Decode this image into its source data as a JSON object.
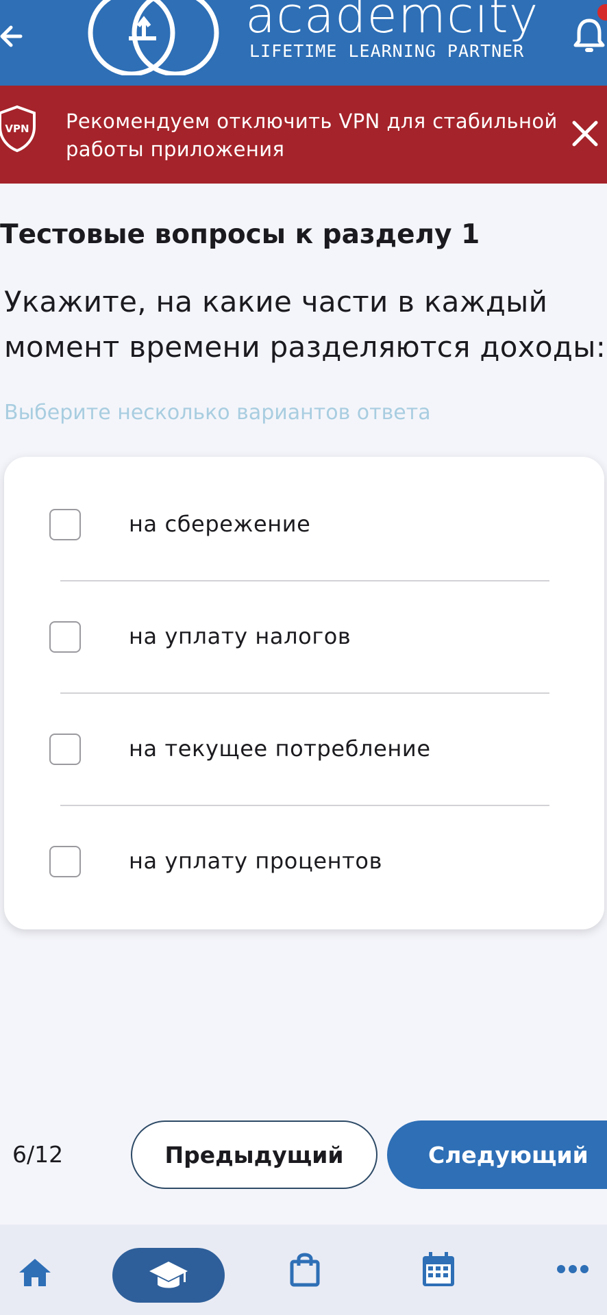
{
  "header": {
    "logo_word": "academcity",
    "logo_tagline": "LIFETIME LEARNING PARTNER",
    "icons": {
      "back": "arrow-left-icon",
      "bell": "bell-icon"
    }
  },
  "vpn_banner": {
    "badge": "VPN",
    "text": "Рекомендуем отключить VPN для стабильной работы приложения",
    "icons": {
      "shield": "vpn-shield-icon",
      "close": "close-icon"
    }
  },
  "content": {
    "section_title": "Тестовые вопросы к разделу 1",
    "question": "Укажите, на какие части в каждый момент времени разделяются доходы:",
    "hint": "Выберите несколько вариантов ответа",
    "options": [
      {
        "label": "на сбережение",
        "checked": false
      },
      {
        "label": "на уплату налогов",
        "checked": false
      },
      {
        "label": "на текущее потребление",
        "checked": false
      },
      {
        "label": "на уплату процентов",
        "checked": false
      }
    ]
  },
  "pager": {
    "progress": "6/12",
    "prev_label": "Предыдущий",
    "next_label": "Следующий"
  },
  "bottom_nav": {
    "items": [
      {
        "icon": "home-icon",
        "active": false
      },
      {
        "icon": "graduation-cap-icon",
        "active": true
      },
      {
        "icon": "shopping-bag-icon",
        "active": false
      },
      {
        "icon": "calendar-icon",
        "active": false
      },
      {
        "icon": "more-icon",
        "active": false
      }
    ]
  },
  "colors": {
    "primary": "#2e6fb6",
    "banner": "#a5232a",
    "hint": "#a8cde0",
    "nav_active": "#2e5f9a",
    "badge": "#d52a2a"
  }
}
